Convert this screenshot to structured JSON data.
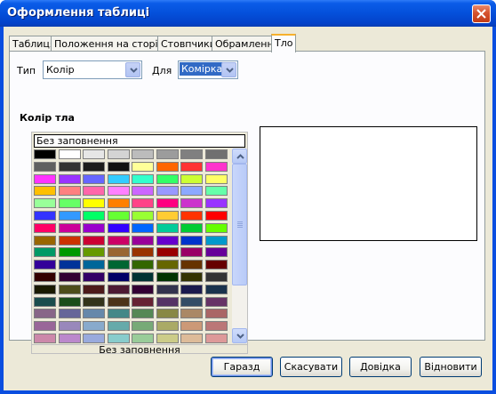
{
  "window": {
    "title": "Оформлення таблиці",
    "close_icon": "close-icon"
  },
  "tabs": [
    {
      "label": "Таблиця",
      "active": false
    },
    {
      "label": "Положення на сторінці",
      "active": false
    },
    {
      "label": "Стовпчики",
      "active": false
    },
    {
      "label": "Обрамлення",
      "active": false
    },
    {
      "label": "Тло",
      "active": true
    }
  ],
  "type_field": {
    "label": "Тип",
    "value": "Колір"
  },
  "for_field": {
    "label": "Для",
    "value": "Комірка"
  },
  "section": {
    "title": "Колір тла"
  },
  "palette": {
    "none_value": "Без заповнення",
    "footer_label": "Без заповнення",
    "colors": [
      [
        "#000000",
        "#ffffff",
        "#e6e6e6",
        "#d4d4d4",
        "#bcbcbc",
        "#9c9c9c",
        "#808080",
        "#707070"
      ],
      [
        "#606060",
        "#333333",
        "#1c1c1c",
        "#111111",
        "#ffff99",
        "#ff6600",
        "#ff3333",
        "#ff33cc"
      ],
      [
        "#ff33ff",
        "#9933ff",
        "#6666ff",
        "#33ccff",
        "#33ffcc",
        "#33ff66",
        "#ccff33",
        "#ffff66"
      ],
      [
        "#ffbf00",
        "#ff8080",
        "#ff66aa",
        "#ff80ff",
        "#cc66ff",
        "#9999ff",
        "#8ca8ff",
        "#66ffaa"
      ],
      [
        "#99ff99",
        "#66ff66",
        "#ffff00",
        "#ff8000",
        "#ff4488",
        "#ff0080",
        "#cc33cc",
        "#9933ff"
      ],
      [
        "#3333ff",
        "#3399ff",
        "#00ff66",
        "#66ff33",
        "#99ff33",
        "#ffcc33",
        "#ff3300",
        "#ff0000"
      ],
      [
        "#ff0066",
        "#cc0099",
        "#9900cc",
        "#3300ff",
        "#0066ff",
        "#00cc99",
        "#00cc33",
        "#66ff00"
      ],
      [
        "#996600",
        "#cc3300",
        "#cc0033",
        "#cc0066",
        "#990099",
        "#6600cc",
        "#0033cc",
        "#0099cc"
      ],
      [
        "#009966",
        "#009900",
        "#669900",
        "#996633",
        "#993300",
        "#990000",
        "#990066",
        "#660099"
      ],
      [
        "#330099",
        "#003399",
        "#006699",
        "#006633",
        "#336600",
        "#666600",
        "#663300",
        "#660000"
      ],
      [
        "#330000",
        "#330033",
        "#330066",
        "#000066",
        "#003333",
        "#003300",
        "#333300",
        "#333333"
      ],
      [
        "#1a1a00",
        "#4d4d1a",
        "#4d1a1a",
        "#4d1a33",
        "#330033",
        "#33334d",
        "#1a1a4d",
        "#1a334d"
      ],
      [
        "#1a4d4d",
        "#1a4d1a",
        "#33331a",
        "#4d3319",
        "#662233",
        "#553366",
        "#334d66",
        "#663366"
      ],
      [
        "#886688",
        "#666699",
        "#6688aa",
        "#448888",
        "#558855",
        "#888844",
        "#aa8866",
        "#aa6666"
      ],
      [
        "#996699",
        "#9988bb",
        "#88aacc",
        "#66aaaa",
        "#77aa77",
        "#aaaa66",
        "#cc9977",
        "#bb7777"
      ],
      [
        "#cc88aa",
        "#bb88cc",
        "#99aadd",
        "#88cccc",
        "#99cc99",
        "#cccc88",
        "#ddbb99",
        "#dd9999"
      ]
    ]
  },
  "buttons": {
    "ok": "Гаразд",
    "cancel": "Скасувати",
    "help": "Довідка",
    "reset": "Відновити"
  },
  "icons": {
    "close": "close-icon",
    "dropdown": "chevron-down-icon",
    "scroll_up": "arrow-up-icon",
    "scroll_down": "arrow-down-icon"
  }
}
